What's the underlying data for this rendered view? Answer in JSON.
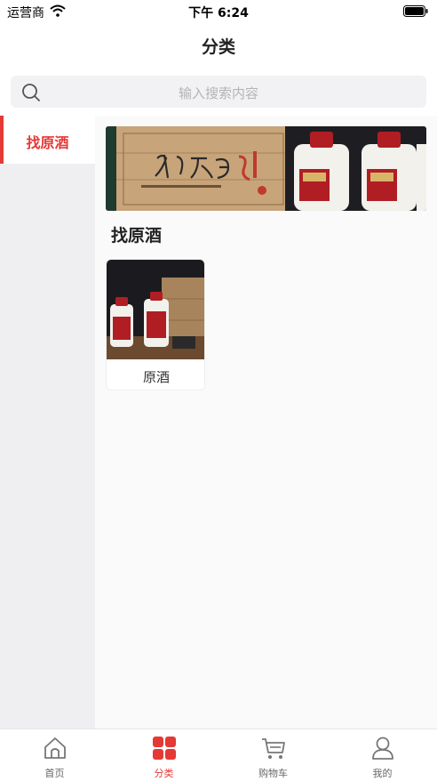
{
  "status_bar": {
    "carrier": "运营商",
    "time": "下午 6:24"
  },
  "nav": {
    "title": "分类"
  },
  "search": {
    "placeholder": "输入搜索内容"
  },
  "sidebar": {
    "items": [
      {
        "label": "找原酒",
        "active": true
      }
    ]
  },
  "content": {
    "section_title": "找原酒",
    "products": [
      {
        "name": "原酒"
      }
    ]
  },
  "tab_bar": {
    "tabs": [
      {
        "label": "首页",
        "icon": "home-icon",
        "active": false
      },
      {
        "label": "分类",
        "icon": "category-grid-icon",
        "active": true
      },
      {
        "label": "购物车",
        "icon": "cart-icon",
        "active": false
      },
      {
        "label": "我的",
        "icon": "profile-icon",
        "active": false
      }
    ]
  },
  "colors": {
    "accent": "#e53935",
    "background": "#fafafa",
    "sidebar_bg": "#efeff1",
    "search_bg": "#f2f2f4"
  }
}
